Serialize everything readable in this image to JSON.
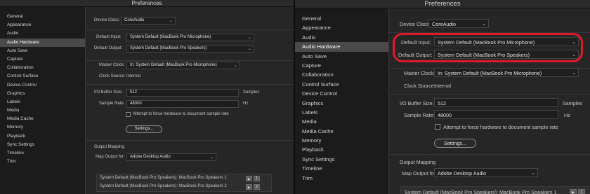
{
  "window_title": "Preferences",
  "sidebar": {
    "items": [
      {
        "label": "General",
        "active": false
      },
      {
        "label": "Appearance",
        "active": false
      },
      {
        "label": "Audio",
        "active": false
      },
      {
        "label": "Audio Hardware",
        "active": true
      },
      {
        "label": "Auto Save",
        "active": false
      },
      {
        "label": "Capture",
        "active": false
      },
      {
        "label": "Collaboration",
        "active": false
      },
      {
        "label": "Control Surface",
        "active": false
      },
      {
        "label": "Device Control",
        "active": false
      },
      {
        "label": "Graphics",
        "active": false
      },
      {
        "label": "Labels",
        "active": false
      },
      {
        "label": "Media",
        "active": false
      },
      {
        "label": "Media Cache",
        "active": false
      },
      {
        "label": "Memory",
        "active": false
      },
      {
        "label": "Playback",
        "active": false
      },
      {
        "label": "Sync Settings",
        "active": false
      },
      {
        "label": "Timeline",
        "active": false
      },
      {
        "label": "Trim",
        "active": false
      }
    ]
  },
  "audio_hardware": {
    "device_class_label": "Device Class:",
    "device_class_value": "CoreAudio",
    "default_input_label": "Default Input:",
    "default_input_value": "System Default (MacBook Pro Microphone)",
    "default_output_label": "Default Output:",
    "default_output_value": "System Default (MacBook Pro Speakers)",
    "master_clock_label": "Master Clock:",
    "master_clock_value": "In: System Default (MacBook Pro Microphone)",
    "clock_source_label": "Clock Source:",
    "clock_source_value": "Internal",
    "io_buffer_label": "I/O Buffer Size:",
    "io_buffer_value": "512",
    "io_buffer_unit": "Samples",
    "sample_rate_label": "Sample Rate:",
    "sample_rate_value": "48000",
    "sample_rate_unit": "Hz",
    "force_rate_label": "Attempt to force hardware to document sample rate",
    "settings_button": "Settings..."
  },
  "output_mapping": {
    "heading": "Output Mapping",
    "map_output_label": "Map Output for:",
    "map_output_value": "Adobe Desktop Audio",
    "rows": [
      {
        "label": "System Default (MacBook Pro Speakers): MacBook Pro Speakers 1",
        "channel": "1"
      },
      {
        "label": "System Default (MacBook Pro Speakers): MacBook Pro Speakers 2",
        "channel": "2"
      }
    ]
  },
  "glyphs": {
    "chevron": "⌄",
    "play": "▶"
  },
  "highlight_color": "#e0192a"
}
